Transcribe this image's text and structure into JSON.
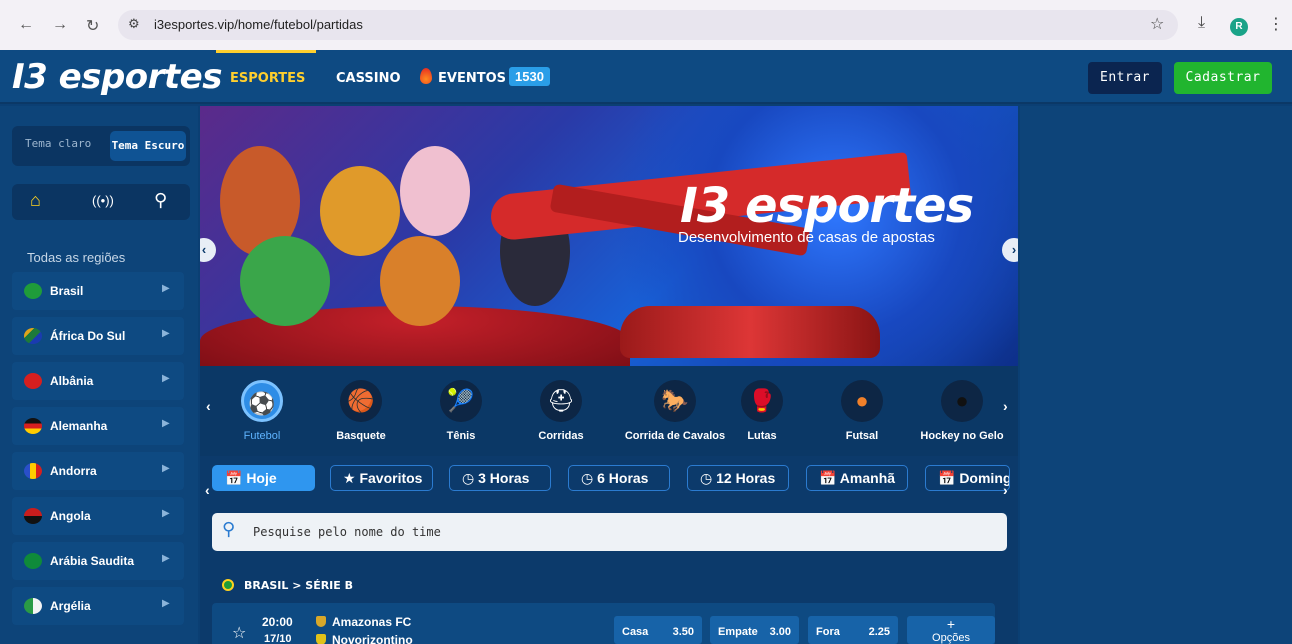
{
  "browser": {
    "url": "i3esportes.vip/home/futebol/partidas",
    "avatar_letter": "R"
  },
  "header": {
    "logo": "I3 esportes",
    "nav": [
      {
        "label": "ESPORTES"
      },
      {
        "label": "CASSINO"
      },
      {
        "label": "EVENTOS"
      }
    ],
    "events_count": "1530",
    "login_label": "Entrar",
    "register_label": "Cadastrar"
  },
  "sidebar": {
    "theme_light": "Tema claro",
    "theme_dark": "Tema Escuro",
    "regions_title": "Todas as regiões",
    "countries": [
      {
        "name": "Brasil",
        "color": "#1f9c3a"
      },
      {
        "name": "África Do Sul",
        "color": "#e0a41b"
      },
      {
        "name": "Albânia",
        "color": "#d61f1f"
      },
      {
        "name": "Alemanha",
        "color": "#1a1a1a"
      },
      {
        "name": "Andorra",
        "color": "#2a4fc9"
      },
      {
        "name": "Angola",
        "color": "#c91d1d"
      },
      {
        "name": "Arábia Saudita",
        "color": "#0f8a3a"
      },
      {
        "name": "Argélia",
        "color": "#2a9a45"
      }
    ]
  },
  "banner": {
    "brand": "I3 esportes",
    "subtitle": "Desenvolvimento de casas de apostas"
  },
  "sports": [
    {
      "label": "Futebol",
      "icon": "⚽"
    },
    {
      "label": "Basquete",
      "icon": "🏀"
    },
    {
      "label": "Tênis",
      "icon": "🎾"
    },
    {
      "label": "Corridas",
      "icon": "⛑"
    },
    {
      "label": "Corrida de Cavalos",
      "icon": "🐎"
    },
    {
      "label": "Lutas",
      "icon": "🥊"
    },
    {
      "label": "Futsal",
      "icon": "●"
    },
    {
      "label": "Hockey no Gelo",
      "icon": "●"
    }
  ],
  "filters": [
    {
      "label": "📅 Hoje"
    },
    {
      "label": "★ Favoritos"
    },
    {
      "label": "◷ 3 Horas"
    },
    {
      "label": "◷ 6 Horas"
    },
    {
      "label": "◷ 12 Horas"
    },
    {
      "label": "📅 Amanhã"
    },
    {
      "label": "📅 Domingo"
    }
  ],
  "search": {
    "placeholder": "Pesquise pelo nome do time"
  },
  "league": {
    "title": "BRASIL > SÉRIE B"
  },
  "match": {
    "time": "20:00",
    "date": "17/10",
    "home": "Amazonas FC",
    "away": "Novorizontino",
    "odds": [
      {
        "label": "Casa",
        "value": "3.50"
      },
      {
        "label": "Empate",
        "value": "3.00"
      },
      {
        "label": "Fora",
        "value": "2.25"
      }
    ],
    "more_label": "Opções"
  }
}
